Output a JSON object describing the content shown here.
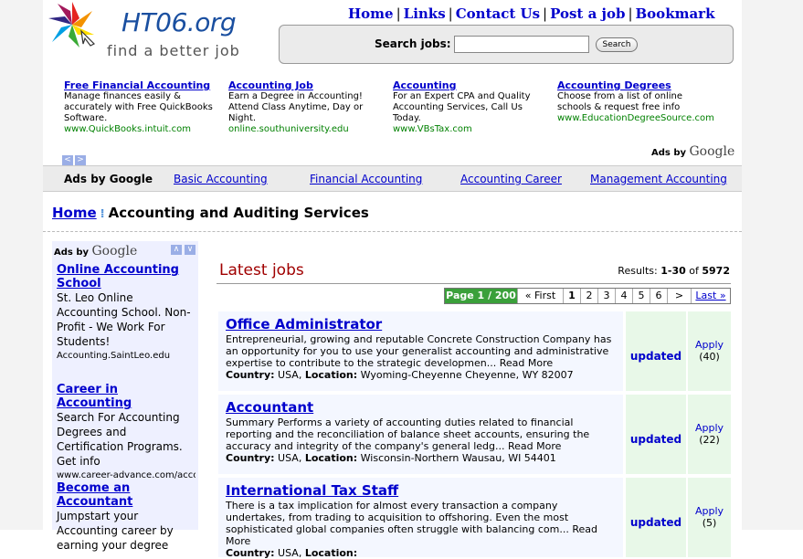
{
  "header": {
    "logo_title": "HT06.org",
    "logo_tagline": "find a better job",
    "nav": [
      "Home",
      "Links",
      "Contact Us",
      "Post a job",
      "Bookmark"
    ],
    "search_label": "Search jobs:",
    "search_value": "",
    "search_button": "Search"
  },
  "ads": [
    {
      "title": "Free Financial Accounting",
      "text": "Manage finances easily & accurately with Free QuickBooks Software.",
      "url": "www.QuickBooks.intuit.com"
    },
    {
      "title": "Accounting Job",
      "text": "Earn a Degree in Accounting! Attend Class Anytime, Day or Night.",
      "url": "online.southuniversity.edu"
    },
    {
      "title": "Accounting",
      "text": "For an Expert CPA and Quality Accounting Services, Call Us Today.",
      "url": "www.VBsTax.com"
    },
    {
      "title": "Accounting Degrees",
      "text": "Choose from a list of online schools & request free info",
      "url": "www.EducationDegreeSource.com"
    }
  ],
  "ads_by": "Ads by",
  "google": "Google",
  "linkbar": {
    "lead": "Ads by Google",
    "links": [
      "Basic Accounting",
      "Financial Accounting",
      "Accounting Career",
      "Management Accounting"
    ]
  },
  "breadcrumb": {
    "home": "Home",
    "current": "Accounting and Auditing Services"
  },
  "left_ads": [
    {
      "title": "Online Accounting School",
      "text": "St. Leo Online Accounting School. Non-Profit - We Work For Students!",
      "url": "Accounting.SaintLeo.edu"
    },
    {
      "title": "Career in Accounting",
      "text": "Search For Accounting Degrees and Certification Programs. Get info",
      "url": "www.career-advance.com/accou"
    },
    {
      "title": "Become an Accountant",
      "text": "Jumpstart your Accounting career by earning your degree",
      "url": ""
    }
  ],
  "main": {
    "heading": "Latest jobs",
    "results_label": "Results:",
    "results_range": "1-30",
    "results_of": "of",
    "results_total": "5972"
  },
  "pager": {
    "page_label": "Page 1 / 200",
    "first": "« First",
    "pages": [
      "1",
      "2",
      "3",
      "4",
      "5",
      "6"
    ],
    "next": ">",
    "last": "Last »"
  },
  "jobs": [
    {
      "title": "Office Administrator",
      "desc": "Entrepreneurial, growing and reputable Concrete Construction Company has an opportunity for you to use your generalist accounting and administrative expertise to contribute to the strategic developmen... Read More",
      "country_label": "Country:",
      "country": "USA",
      "location_label": "Location:",
      "location": "Wyoming-Cheyenne Cheyenne, WY 82007",
      "status": "updated",
      "apply": "Apply",
      "apply_count": "(40)"
    },
    {
      "title": "Accountant",
      "desc": "Summary  Performs a variety of accounting duties related to financial reporting and the reconciliation of balance sheet accounts, ensuring the accuracy and integrity of the company's general ledg... Read More",
      "country_label": "Country:",
      "country": "USA",
      "location_label": "Location:",
      "location": "Wisconsin-Northern Wausau, WI 54401",
      "status": "updated",
      "apply": "Apply",
      "apply_count": "(22)"
    },
    {
      "title": "International Tax Staff",
      "desc": "There is a tax implication for almost every transaction a company undertakes, from trading to acquisition to offshoring. Even the most sophisticated global companies often struggle with balancing com... Read More",
      "country_label": "Country:",
      "country": "USA",
      "location_label": "Location:",
      "location": "",
      "status": "updated",
      "apply": "Apply",
      "apply_count": "(5)"
    }
  ]
}
